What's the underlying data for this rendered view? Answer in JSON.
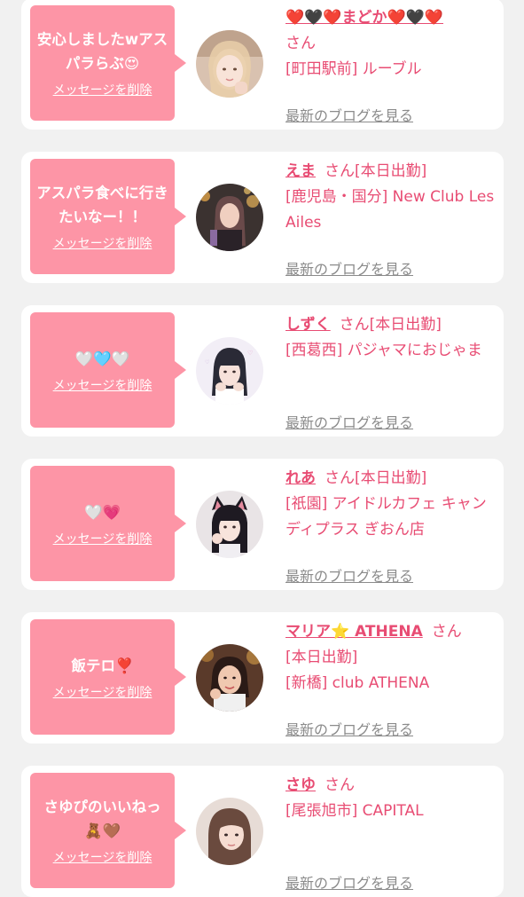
{
  "colors": {
    "page_bg": "#f1f1f1",
    "bubble": "#fd95a6",
    "accent": "#e84c73",
    "link_gray": "#8b8b8b"
  },
  "common": {
    "delete_label": "メッセージを削除",
    "san_label": "さん",
    "blog_label": "最新のブログを見る"
  },
  "items": [
    {
      "message": "安心しましたwアスパラらぶ😍",
      "name": "❤️🖤❤️まどか❤️🖤❤️",
      "duty": "",
      "shop": "[町田駅前] ルーブル",
      "avatar_icon": "girl-avatar-blonde"
    },
    {
      "message": "アスパラ食べに行きたいなー！！",
      "name": "えま",
      "duty": "[本日出勤]",
      "shop": "[鹿児島・国分] New Club Les Ailes",
      "avatar_icon": "girl-avatar-dark"
    },
    {
      "message": "🤍🩵🤍",
      "name": "しずく",
      "duty": "[本日出勤]",
      "shop": "[西葛西] パジャマにおじゃま",
      "avatar_icon": "girl-avatar-pajama"
    },
    {
      "message": "🤍💗",
      "name": "れあ",
      "duty": "[本日出勤]",
      "shop": "[祇園] アイドルカフェ キャンディプラス ぎおん店",
      "avatar_icon": "girl-avatar-cat-ears"
    },
    {
      "message": "飯テロ❣️",
      "name": "マリア⭐️ ATHENA",
      "duty": "[本日出勤]",
      "shop": "[新橋] club ATHENA",
      "avatar_icon": "girl-avatar-club"
    },
    {
      "message": "さゆぴのいいねっ🧸🤎",
      "name": "さゆ",
      "duty": "",
      "shop": "[尾張旭市] CAPITAL",
      "avatar_icon": "girl-avatar-brown"
    }
  ]
}
